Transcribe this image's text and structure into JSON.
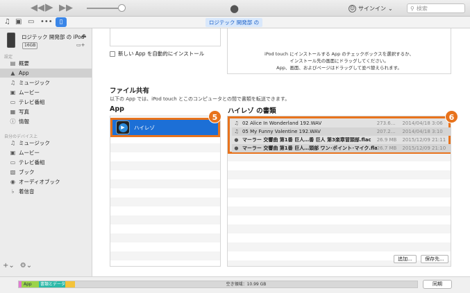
{
  "titlebar": {
    "signin_label": "サインイン",
    "search_placeholder": "検索"
  },
  "toolbar": {
    "device_tab": "ロジテック 開発部 の iPod"
  },
  "sidebar": {
    "device_name": "ロジテック 開発部 の iPod",
    "capacity": "16GB",
    "settings_header": "設定",
    "settings_items": [
      {
        "label": "概要",
        "icon": "summary-icon"
      },
      {
        "label": "App",
        "icon": "app-icon"
      },
      {
        "label": "ミュージック",
        "icon": "music-icon"
      },
      {
        "label": "ムービー",
        "icon": "movie-icon"
      },
      {
        "label": "テレビ番組",
        "icon": "tv-icon"
      },
      {
        "label": "写真",
        "icon": "photo-icon"
      },
      {
        "label": "情報",
        "icon": "info-icon"
      }
    ],
    "ondevice_header": "自分のデバイス上",
    "ondevice_items": [
      {
        "label": "ミュージック",
        "icon": "music-icon"
      },
      {
        "label": "ムービー",
        "icon": "movie-icon"
      },
      {
        "label": "テレビ番組",
        "icon": "tv-icon"
      },
      {
        "label": "ブック",
        "icon": "book-icon"
      },
      {
        "label": "オーディオブック",
        "icon": "audiobook-icon"
      },
      {
        "label": "着信音",
        "icon": "bell-icon"
      }
    ]
  },
  "main": {
    "auto_install_label": "新しい App を自動的にインストール",
    "hint_lines": [
      "iPod touch にインストールする App のチェックボックスを選択するか、",
      "インストール先の画面にドラッグしてください。",
      "App、画面、およびページはドラッグして並べ替えられます。"
    ],
    "file_sharing_title": "ファイル共有",
    "file_sharing_desc": "以下の App では、iPod touch とこのコンピュータとの間で書類を転送できます。",
    "app_column_title": "App",
    "docs_column_title": "ハイレゾ の書類",
    "app_selected": "ハイレゾ",
    "documents": [
      {
        "name": "02 Alice In Wonderland 192.WAV",
        "size": "273.6…",
        "date": "2014/04/18 3:06",
        "type": "wav"
      },
      {
        "name": "05 My Funny Valentine 192.WAV",
        "size": "207.2…",
        "date": "2014/04/18 3:10",
        "type": "wav"
      },
      {
        "name": "マーラー 交響曲 第1番 巨人…番 巨人  第3楽章冒頭部.flac",
        "size": "26.9 MB",
        "date": "2015/12/09 21:11",
        "type": "flac"
      },
      {
        "name": "マーラー 交響曲 第1番 巨人…頭部 ワン･ポイント･マイク.flac",
        "size": "26.7 MB",
        "date": "2015/12/09 21:10",
        "type": "flac"
      }
    ],
    "add_button": "追加...",
    "save_button": "保存先..."
  },
  "callouts": {
    "app_badge": "5",
    "docs_badge": "6"
  },
  "statusbar": {
    "cap_app": "App",
    "cap_books": "書類とデータ",
    "free_space": "空き領域：10.99 GB",
    "sync_button": "同期"
  },
  "colors": {
    "accent": "#1c6fd6",
    "callout": "#e8731c"
  }
}
